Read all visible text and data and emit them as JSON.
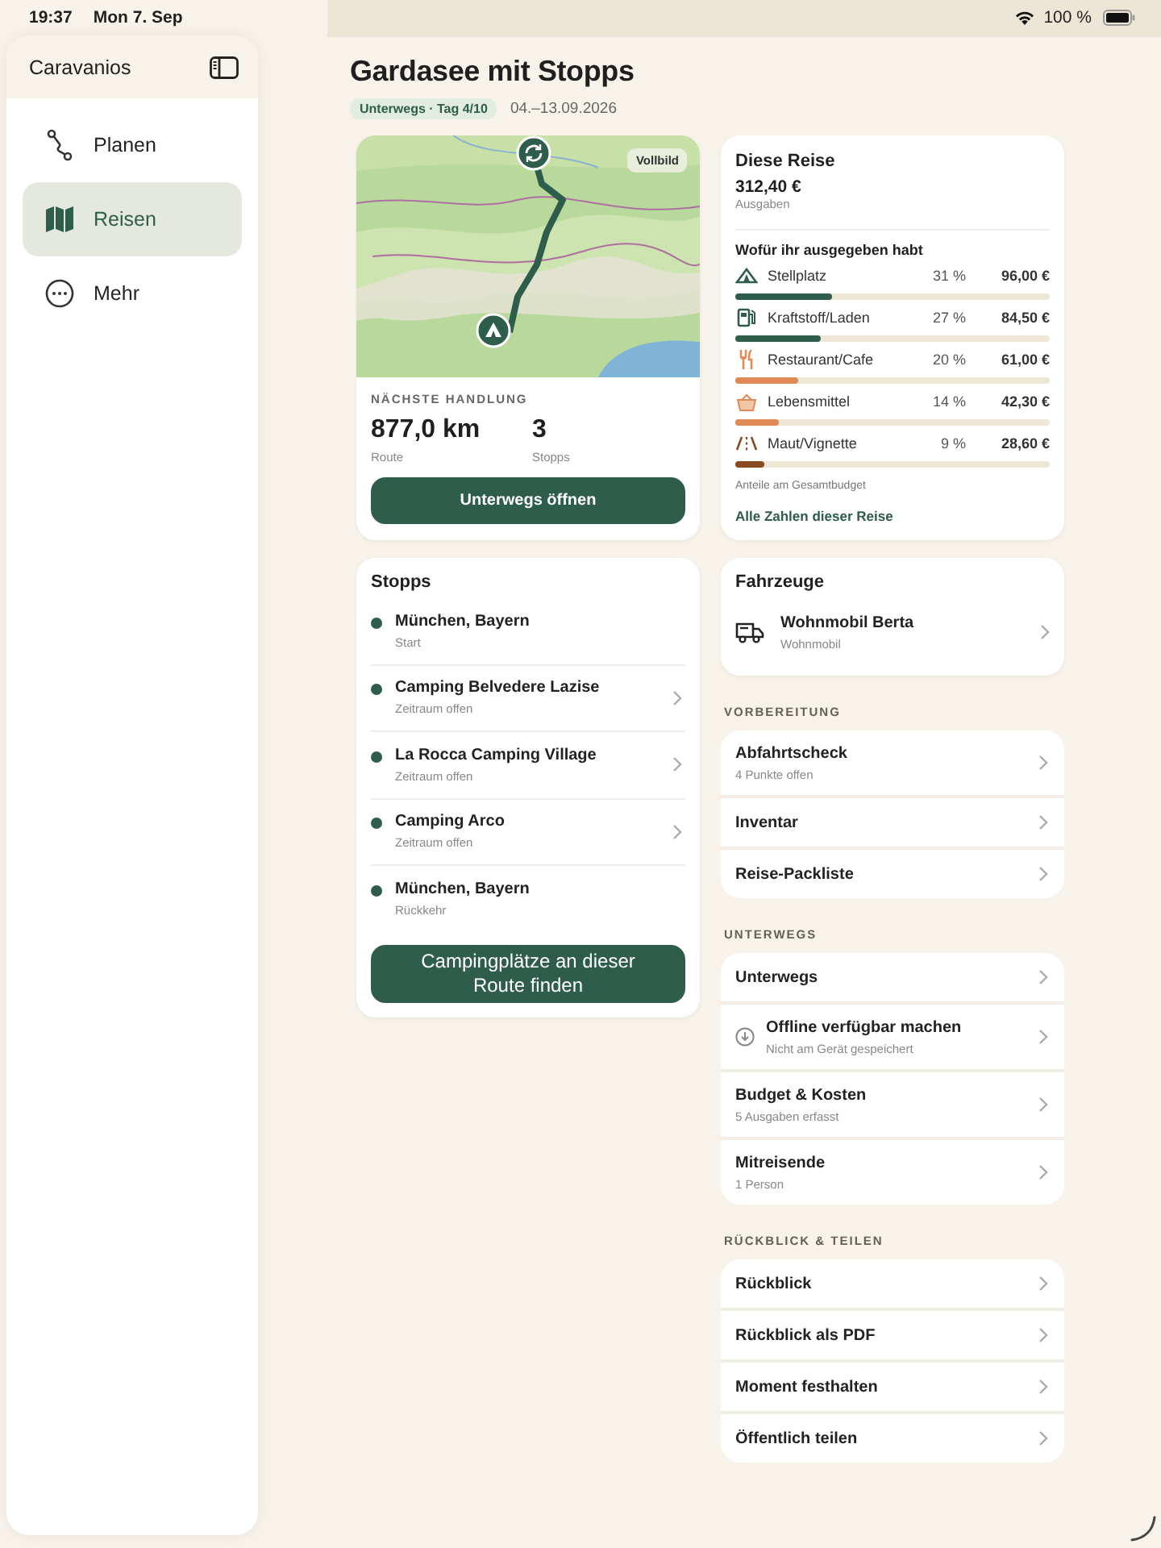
{
  "status_bar": {
    "time": "19:37",
    "date": "Mon 7. Sep",
    "battery": "100 %"
  },
  "sidebar": {
    "title": "Caravanios",
    "items": [
      {
        "label": "Planen",
        "kind": "route",
        "selected": false
      },
      {
        "label": "Reisen",
        "kind": "map",
        "selected": true
      },
      {
        "label": "Mehr",
        "kind": "more",
        "selected": false
      }
    ]
  },
  "trip": {
    "title": "Gardasee mit Stopps",
    "status": "Unterwegs · Tag 4/10",
    "dates": "04.–13.09.2026"
  },
  "map_card": {
    "map": {
      "kind": "picture",
      "fullscreen_button": "Vollbild"
    },
    "next_action_label": "NÄCHSTE HANDLUNG",
    "stats": [
      {
        "value": "877,0 km",
        "label": "Route"
      },
      {
        "value": "3",
        "label": "Stopps"
      }
    ],
    "button": "Unterwegs öffnen"
  },
  "stops": {
    "title": "Stopps",
    "items": [
      {
        "name": "München, Bayern",
        "detail": "Start",
        "navigable": false
      },
      {
        "name": "Camping Belvedere Lazise",
        "detail": "Zeitraum offen",
        "navigable": true
      },
      {
        "name": "La Rocca Camping Village",
        "detail": "Zeitraum offen",
        "navigable": true
      },
      {
        "name": "Camping Arco",
        "detail": "Zeitraum offen",
        "navigable": true
      },
      {
        "name": "München, Bayern",
        "detail": "Rückkehr",
        "navigable": false
      }
    ],
    "button": "Campingplätze an dieser Route finden"
  },
  "budget": {
    "title": "Diese Reise",
    "total": "312,40 €",
    "total_label": "Ausgaben",
    "breakdown_title": "Wofür ihr ausgegeben habt",
    "categories": [
      {
        "name": "Stellplatz",
        "kind": "tent",
        "percent": "31 %",
        "amount": "96,00 €",
        "level": 0.31,
        "color": "#2f5d4b"
      },
      {
        "name": "Kraftstoff/Laden",
        "kind": "fuel",
        "percent": "27 %",
        "amount": "84,50 €",
        "level": 0.27,
        "color": "#2f5d4b"
      },
      {
        "name": "Restaurant/Cafe",
        "kind": "food",
        "percent": "20 %",
        "amount": "61,00 €",
        "level": 0.2,
        "color": "#e08a55"
      },
      {
        "name": "Lebensmittel",
        "kind": "basket",
        "percent": "14 %",
        "amount": "42,30 €",
        "level": 0.14,
        "color": "#e08a55"
      },
      {
        "name": "Maut/Vignette",
        "kind": "road",
        "percent": "9 %",
        "amount": "28,60 €",
        "level": 0.09,
        "color": "#8a4a22"
      }
    ],
    "footnote": "Anteile am Gesamtbudget",
    "link": "Alle Zahlen dieser Reise"
  },
  "vehicles": {
    "title": "Fahrzeuge",
    "items": [
      {
        "name": "Wohnmobil Berta",
        "type": "Wohnmobil"
      }
    ]
  },
  "sections": [
    {
      "header": "VORBEREITUNG",
      "rows": [
        {
          "title": "Abfahrtscheck",
          "subtitle": "4 Punkte offen",
          "kind": "plain"
        },
        {
          "title": "Inventar",
          "kind": "plain"
        },
        {
          "title": "Reise-Packliste",
          "kind": "plain"
        }
      ]
    },
    {
      "header": "UNTERWEGS",
      "rows": [
        {
          "title": "Unterwegs",
          "kind": "plain"
        },
        {
          "title": "Offline verfügbar machen",
          "subtitle": "Nicht am Gerät gespeichert",
          "kind": "download"
        },
        {
          "title": "Budget & Kosten",
          "subtitle": "5 Ausgaben erfasst",
          "kind": "plain"
        },
        {
          "title": "Mitreisende",
          "subtitle": "1 Person",
          "kind": "plain"
        }
      ]
    },
    {
      "header": "RÜCKBLICK & TEILEN",
      "rows": [
        {
          "title": "Rückblick",
          "kind": "plain"
        },
        {
          "title": "Rückblick als PDF",
          "kind": "plain"
        },
        {
          "title": "Moment festhalten",
          "kind": "plain"
        },
        {
          "title": "Öffentlich teilen",
          "kind": "plain"
        }
      ]
    }
  ]
}
